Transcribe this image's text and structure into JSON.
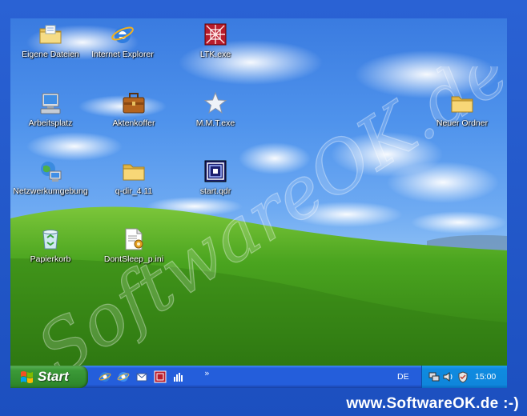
{
  "desktop": {
    "icons": [
      {
        "label": "Eigene Dateien",
        "icon": "my-documents-folder-icon"
      },
      {
        "label": "Internet Explorer",
        "icon": "internet-explorer-icon"
      },
      {
        "label": "LTK.exe",
        "icon": "ltk-exe-icon"
      },
      {
        "label": "Arbeitsplatz",
        "icon": "my-computer-icon"
      },
      {
        "label": "Aktenkoffer",
        "icon": "briefcase-icon"
      },
      {
        "label": "M.M.T.exe",
        "icon": "star-icon"
      },
      {
        "label": "Neuer Ordner",
        "icon": "folder-icon"
      },
      {
        "label": "Netzwerkumgebung",
        "icon": "network-places-icon"
      },
      {
        "label": "q-dir_4.11",
        "icon": "folder-icon"
      },
      {
        "label": "start.qdr",
        "icon": "qdir-file-icon"
      },
      {
        "label": "Papierkorb",
        "icon": "recycle-bin-icon"
      },
      {
        "label": "DontSleep_p.ini",
        "icon": "ini-file-icon"
      }
    ],
    "watermark": "SoftwareOK.de"
  },
  "taskbar": {
    "start_label": "Start",
    "quick_launch": [
      "ie-icon",
      "ie-icon",
      "outlook-icon",
      "ltk-icon",
      "bars-icon"
    ],
    "chevron": "»",
    "language": "DE",
    "tray_icons": [
      "network-icon",
      "volume-icon",
      "security-icon"
    ],
    "clock": "15:00"
  },
  "footer": {
    "brand": "www.SoftwareOK.de :-)"
  },
  "colors": {
    "taskbar_blue": "#245edb",
    "start_green": "#3c9a38",
    "tray_blue": "#0f8be0"
  }
}
